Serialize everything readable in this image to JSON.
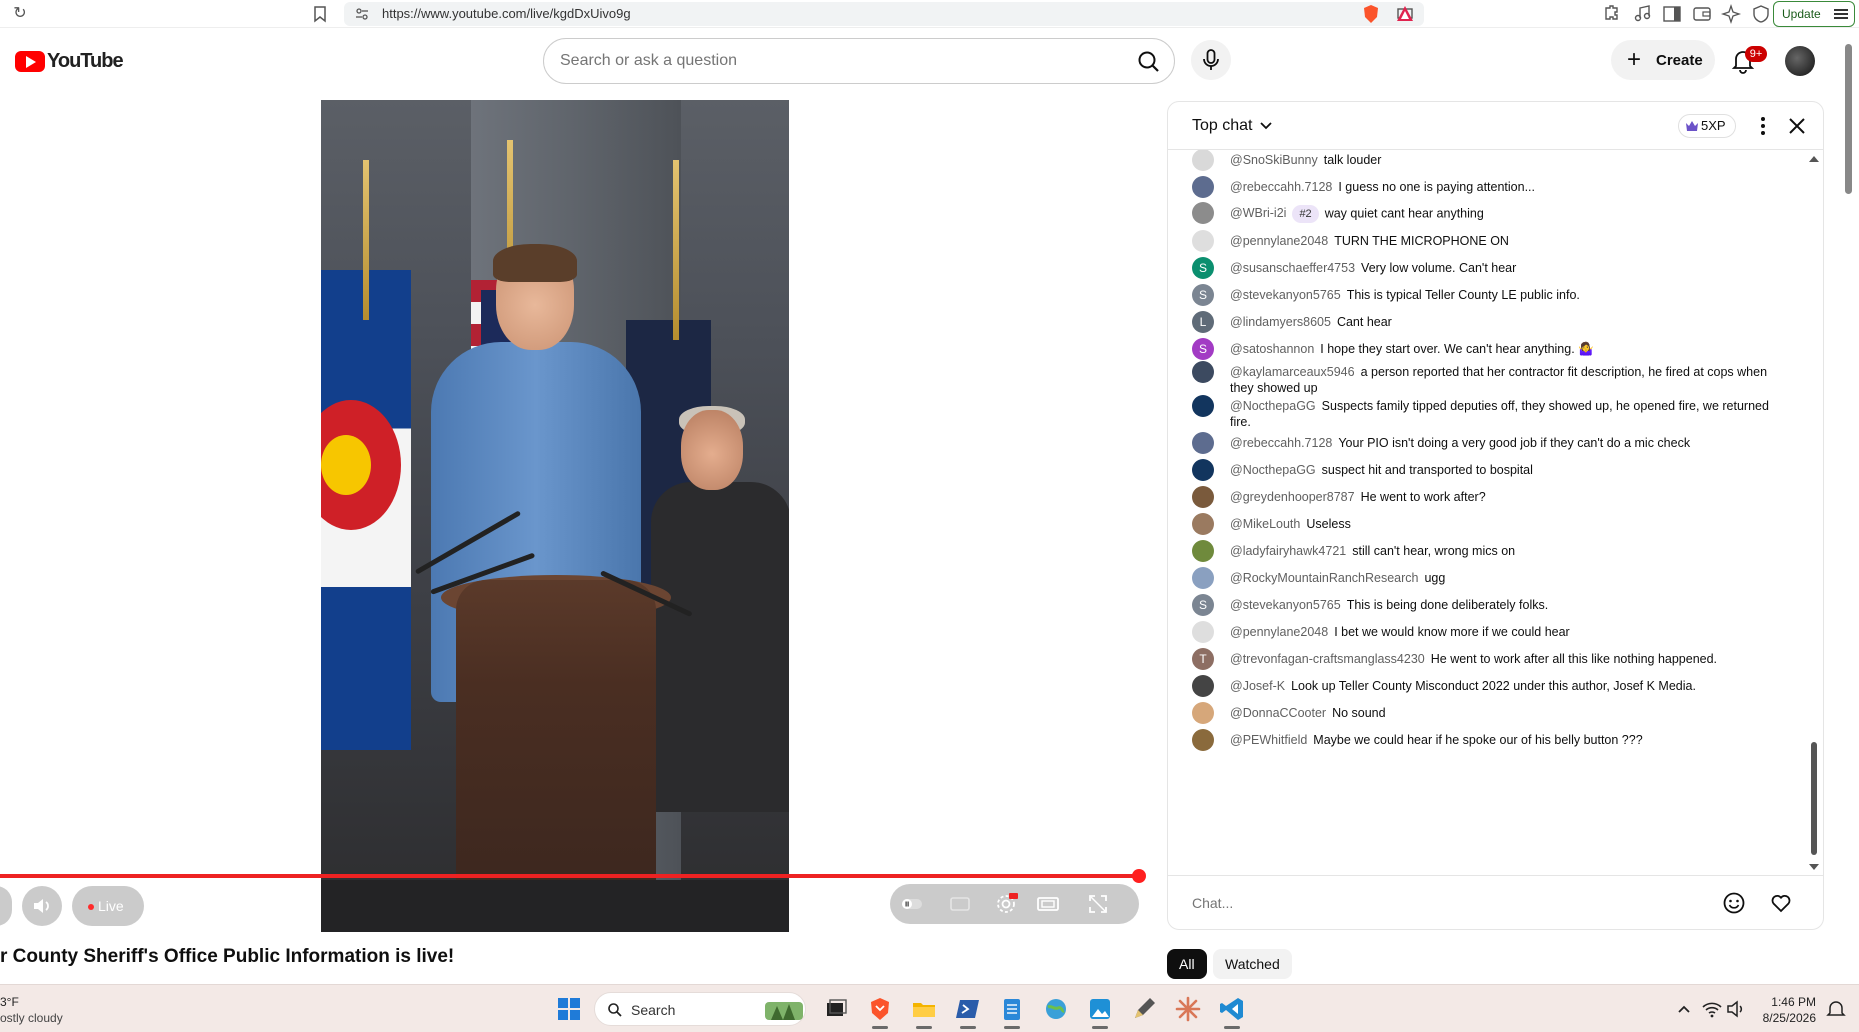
{
  "browser": {
    "url": "https://www.youtube.com/live/kgdDxUivo9g",
    "update_label": "Update"
  },
  "header": {
    "logo_text": "YouTube",
    "search_placeholder": "Search or ask a question",
    "create_label": "Create",
    "notifications_badge": "9+"
  },
  "player": {
    "live_label": "Live",
    "progress": 1.0,
    "title": "r County Sheriff's Office Public Information is live!"
  },
  "chat": {
    "mode_label": "Top chat",
    "xp_label": "5XP",
    "input_placeholder": "Chat...",
    "messages": [
      {
        "author": "@SnoSkiBunny",
        "text": "talk louder",
        "avatar_letter": "",
        "avatar_color": "#d9d9d9"
      },
      {
        "author": "@rebeccahh.7128",
        "text": "I guess no one is paying attention...",
        "avatar_letter": "",
        "avatar_color": "#5d6c8f"
      },
      {
        "author": "@WBri-i2i",
        "badge": "#2",
        "text": "way quiet cant hear anything",
        "avatar_letter": "",
        "avatar_color": "#8c8c8c"
      },
      {
        "author": "@pennylane2048",
        "text": "TURN THE MICROPHONE ON",
        "avatar_letter": "",
        "avatar_color": "#dedede"
      },
      {
        "author": "@susanschaeffer4753",
        "text": "Very low volume. Can't hear",
        "avatar_letter": "S",
        "avatar_color": "#0b8f6f"
      },
      {
        "author": "@stevekanyon5765",
        "text": "This is typical Teller County LE public info.",
        "avatar_letter": "S",
        "avatar_color": "#7b8592"
      },
      {
        "author": "@lindamyers8605",
        "text": "Cant hear",
        "avatar_letter": "L",
        "avatar_color": "#5f6b78"
      },
      {
        "author": "@satoshannon",
        "text": "I hope they start over. We can't hear anything. 🤷‍♀️",
        "avatar_letter": "S",
        "avatar_color": "#a23bc4"
      },
      {
        "author": "@kaylamarceaux5946",
        "text": "a person reported that her contractor fit description, he fired at cops when they showed up",
        "avatar_letter": "",
        "avatar_color": "#3c4a60"
      },
      {
        "author": "@NocthераGG",
        "text": "Suspects family tipped deputies off, they showed up, he opened fire, we returned fire.",
        "avatar_letter": "",
        "avatar_color": "#12355e"
      },
      {
        "author": "@rebeccahh.7128",
        "text": "Your PIO isn't doing a very good job if they can't do a mic check",
        "avatar_letter": "",
        "avatar_color": "#5d6c8f"
      },
      {
        "author": "@NocthераGG",
        "text": "suspect hit and transported to bospital",
        "avatar_letter": "",
        "avatar_color": "#12355e"
      },
      {
        "author": "@greydenhooper8787",
        "text": "He went to work after?",
        "avatar_letter": "",
        "avatar_color": "#7a5a3c"
      },
      {
        "author": "@MikeLouth",
        "text": "Useless",
        "avatar_letter": "",
        "avatar_color": "#9a7a60"
      },
      {
        "author": "@ladyfairyhawk4721",
        "text": "still can't hear, wrong mics on",
        "avatar_letter": "",
        "avatar_color": "#6f8a3c"
      },
      {
        "author": "@RockyMountainRanchResearch",
        "text": "ugg",
        "avatar_letter": "",
        "avatar_color": "#8aa0c0"
      },
      {
        "author": "@stevekanyon5765",
        "text": "This is being done deliberately folks.",
        "avatar_letter": "S",
        "avatar_color": "#7b8592"
      },
      {
        "author": "@pennylane2048",
        "text": "I bet we would know more if we could hear",
        "avatar_letter": "",
        "avatar_color": "#dedede"
      },
      {
        "author": "@trevonfagan-craftsmanglass4230",
        "text": "He went to work after all this like nothing happened.",
        "avatar_letter": "T",
        "avatar_color": "#8d6e63"
      },
      {
        "author": "@Josef-K",
        "text": "Look up Teller County Misconduct 2022 under this author, Josef K Media.",
        "avatar_letter": "",
        "avatar_color": "#444444"
      },
      {
        "author": "@DonnaCCooter",
        "text": "No sound",
        "avatar_letter": "",
        "avatar_color": "#d6a77a"
      },
      {
        "author": "@PEWhitfield",
        "text": "Maybe we could hear if he spoke our of his belly button ???",
        "avatar_letter": "",
        "avatar_color": "#8a6a3c"
      }
    ]
  },
  "filters": {
    "all_label": "All",
    "watched_label": "Watched"
  },
  "taskbar": {
    "weather_temp": "3°F",
    "weather_desc": "ostly cloudy",
    "search_label": "Search",
    "time": "1:46 PM",
    "date": "8/25/2026"
  },
  "colors": {
    "youtube_red": "#ff0000",
    "progress_red": "#e22222",
    "accent_dark": "#0f0f0f"
  }
}
